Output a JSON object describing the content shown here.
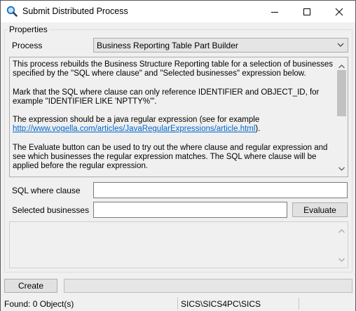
{
  "window": {
    "title": "Submit Distributed Process",
    "controls": {
      "minimize": "minimize",
      "maximize": "maximize",
      "close": "close"
    }
  },
  "properties": {
    "group_label": "Properties",
    "process_label": "Process",
    "process_value": "Business Reporting Table Part Builder",
    "description": {
      "para1": "This process rebuilds the Business Structure Reporting table for a selection of businesses specified by the \"SQL where clause\" and \"Selected businesses\" expression below.",
      "para2": "Mark that the SQL where clause can only reference IDENTIFIER and OBJECT_ID, for example \"IDENTIFIER LIKE 'NPTTY%'\".",
      "para3_text": "The expression should be a java regular expression (see for example",
      "para3_link": "http://www.vogella.com/articles/JavaRegularExpressions/article.html",
      "para3_end": ").",
      "para4": "The Evaluate button can be used to try out the where clause and regular expression and see which businesses the regular expression matches. The SQL where clause will be applied before the regular expression."
    },
    "sql_label": "SQL where clause",
    "sql_value": "",
    "selected_label": "Selected businesses",
    "selected_value": "",
    "evaluate_label": "Evaluate"
  },
  "actions": {
    "create_label": "Create"
  },
  "status": {
    "found": "Found: 0 Object(s)",
    "connection": "SICS\\SICS4PC\\SICS"
  }
}
